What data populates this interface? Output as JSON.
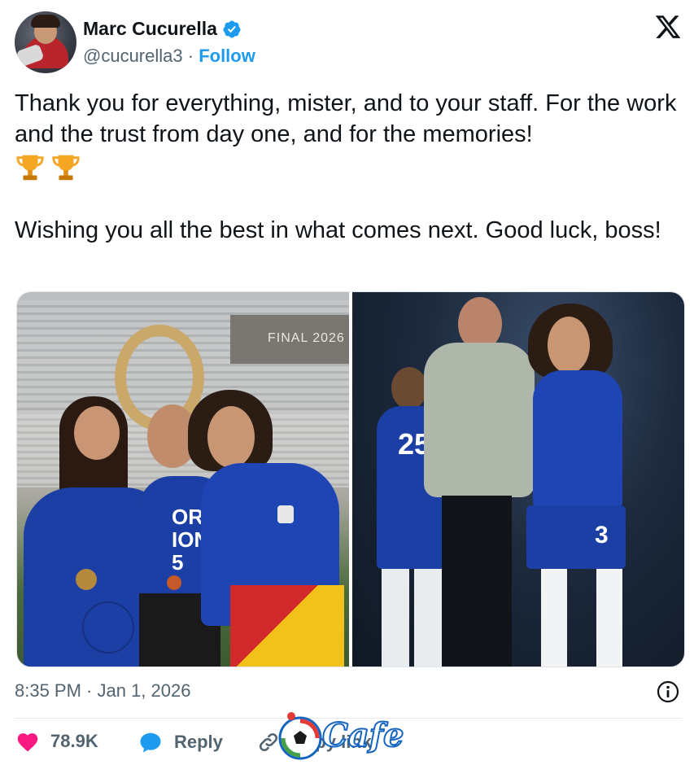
{
  "user": {
    "display_name": "Marc Cucurella",
    "handle": "@cucurella3",
    "separator": " · ",
    "follow_label": "Follow"
  },
  "tweet": {
    "line1": "Thank you for everything, mister, and to your staff. For the work and the trust from day one, and for the memories!",
    "trophy_count": 2,
    "line2": "Wishing you all the best in what comes next. Good luck, boss!"
  },
  "media": {
    "photo_left_text": "FINAL 2026",
    "photo_left_shirt_text": "ORLD IONS 5",
    "photo_right_numbers": [
      "25",
      "3"
    ]
  },
  "meta": {
    "timestamp": "8:35 PM · Jan 1, 2026"
  },
  "actions": {
    "like_count": "78.9K",
    "reply_label": "Reply",
    "copy_label": "Copy link"
  },
  "watermark": {
    "text": "Cafe"
  },
  "colors": {
    "accent": "#1d9bf0",
    "like": "#f91880",
    "verified": "#1d9bf0",
    "muted_text": "#536471",
    "chelsea_blue": "#1c3fa5"
  }
}
